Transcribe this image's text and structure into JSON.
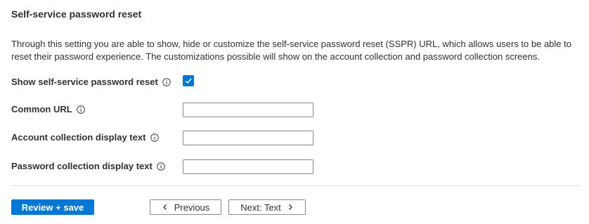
{
  "section": {
    "title": "Self-service password reset",
    "description": "Through this setting you are able to show, hide or customize the self-service password reset (SSPR) URL, which allows users to be able to reset their password experience. The customizations possible will show on the account collection and password collection screens."
  },
  "fields": {
    "show_sspr": {
      "label": "Show self-service password reset",
      "checked": true
    },
    "common_url": {
      "label": "Common URL",
      "value": ""
    },
    "account_collection_text": {
      "label": "Account collection display text",
      "value": ""
    },
    "password_collection_text": {
      "label": "Password collection display text",
      "value": ""
    }
  },
  "footer": {
    "review_save_label": "Review + save",
    "previous_label": "Previous",
    "next_label": "Next: Text"
  },
  "colors": {
    "accent": "#0078d4",
    "text": "#323130",
    "border": "#8a8886",
    "divider": "#e1dfdd"
  },
  "icons": {
    "info": "info-icon",
    "check": "checkmark-icon",
    "prev": "chevron-left-icon",
    "next": "chevron-right-icon"
  }
}
